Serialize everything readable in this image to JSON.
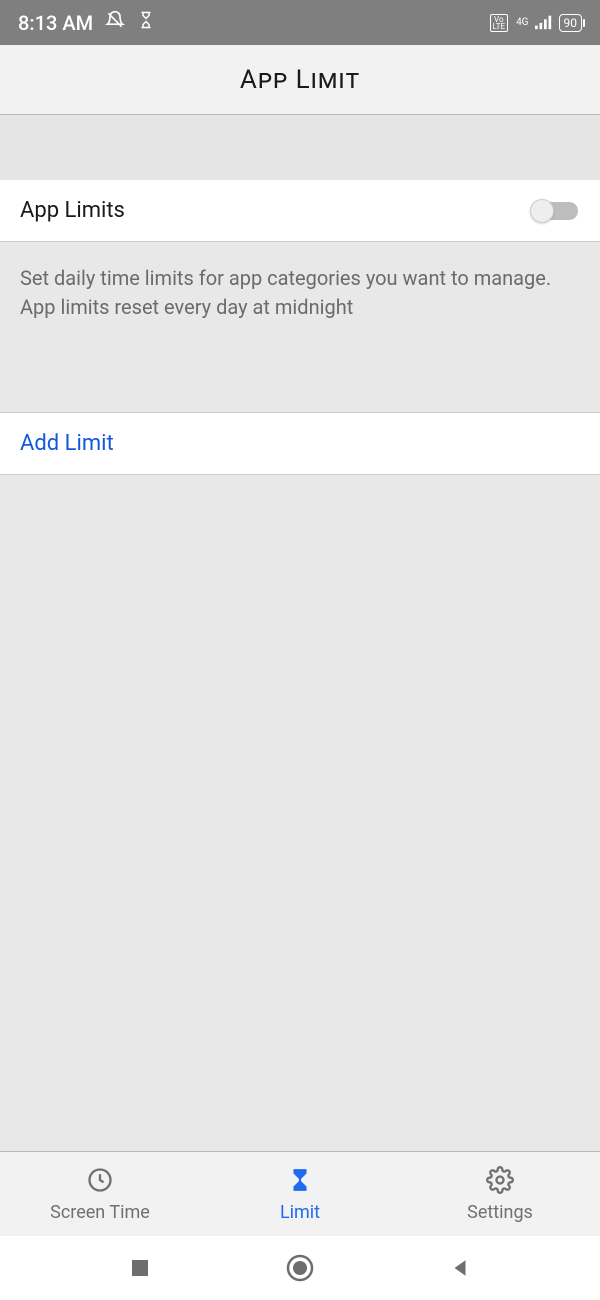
{
  "status": {
    "time": "8:13 AM",
    "network_type": "4G",
    "battery": "90"
  },
  "header": {
    "title": "App Limit"
  },
  "toggle": {
    "label": "App Limits",
    "state": "off"
  },
  "description": "Set daily time limits for app categories you want to manage. App limits reset every day at midnight",
  "add_limit": "Add Limit",
  "bottom_nav": [
    {
      "label": "Screen Time",
      "active": false
    },
    {
      "label": "Limit",
      "active": true
    },
    {
      "label": "Settings",
      "active": false
    }
  ]
}
